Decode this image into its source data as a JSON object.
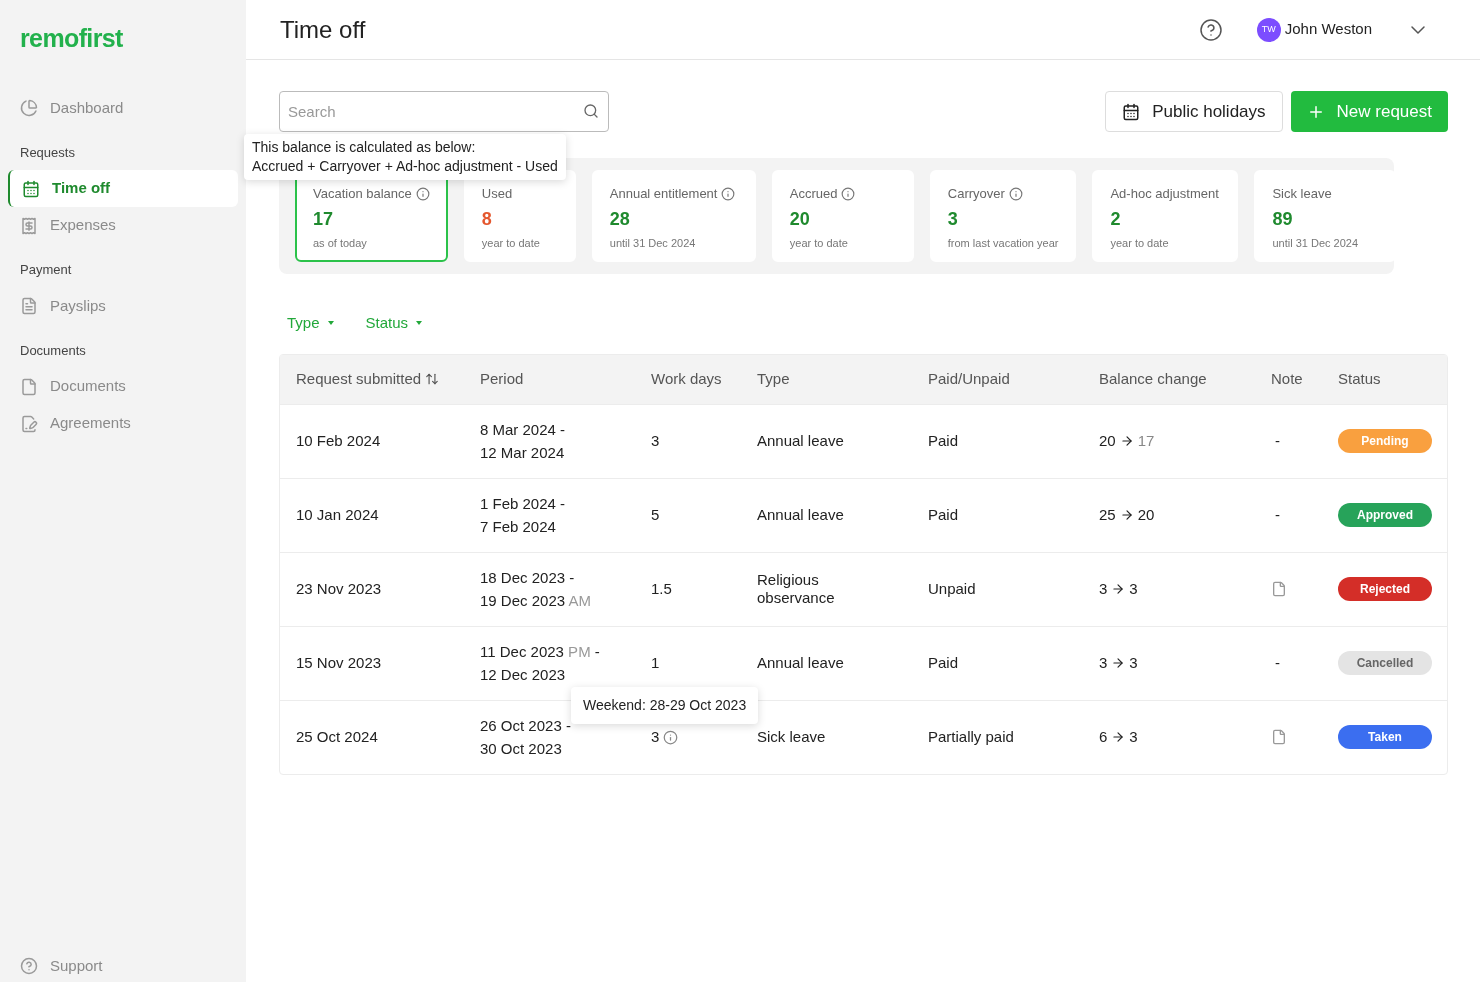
{
  "sidebar": {
    "logo": "remofirst",
    "sections": [
      {
        "items": [
          {
            "label": "Dashboard",
            "selected": false
          }
        ]
      },
      {
        "heading": "Requests",
        "items": [
          {
            "label": "Time off",
            "selected": true
          },
          {
            "label": "Expenses",
            "selected": false
          }
        ]
      },
      {
        "heading": "Payment",
        "items": [
          {
            "label": "Payslips",
            "selected": false
          }
        ]
      },
      {
        "heading": "Documents",
        "items": [
          {
            "label": "Documents",
            "selected": false
          },
          {
            "label": "Agreements",
            "selected": false
          }
        ]
      }
    ],
    "support": "Support"
  },
  "header": {
    "title": "Time off",
    "user": {
      "initials": "TW",
      "name": "John Weston"
    }
  },
  "search": {
    "placeholder": "Search"
  },
  "buttons": {
    "public_holidays": "Public holidays",
    "new_request": "New request"
  },
  "balance_tooltip": [
    "This balance is calculated as below:",
    "Accrued + Carryover + Ad-hoc adjustment - Used"
  ],
  "cards": [
    {
      "label": "Vacation balance",
      "info": true,
      "value": "17",
      "caption": "as of today",
      "color": "#1f8a2e",
      "selected": true
    },
    {
      "label": "Used",
      "info": false,
      "value": "8",
      "caption": "year to date",
      "color": "#e4572e",
      "selected": false
    },
    {
      "label": "Annual entitlement",
      "info": true,
      "value": "28",
      "caption": "until 31 Dec 2024",
      "color": "#1f8a2e",
      "selected": false
    },
    {
      "label": "Accrued",
      "info": true,
      "value": "20",
      "caption": "year to date",
      "color": "#1f8a2e",
      "selected": false
    },
    {
      "label": "Carryover",
      "info": true,
      "value": "3",
      "caption": "from last vacation year",
      "color": "#1f8a2e",
      "selected": false
    },
    {
      "label": "Ad-hoc adjustment",
      "info": false,
      "value": "2",
      "caption": "year to date",
      "color": "#1f8a2e",
      "selected": false
    },
    {
      "label": "Sick leave",
      "info": false,
      "value": "89",
      "caption": "until 31 Dec 2024",
      "color": "#1f8a2e",
      "selected": false
    }
  ],
  "filters": [
    "Type",
    "Status"
  ],
  "table": {
    "columns": [
      {
        "label": "Request submitted",
        "sortable": true
      },
      {
        "label": "Period",
        "sortable": false
      },
      {
        "label": "Work days",
        "sortable": false
      },
      {
        "label": "Type",
        "sortable": false
      },
      {
        "label": "Paid/Unpaid",
        "sortable": false
      },
      {
        "label": "Balance change",
        "sortable": false
      },
      {
        "label": "Note",
        "sortable": false
      },
      {
        "label": "Status",
        "sortable": false
      }
    ],
    "rows": [
      {
        "submitted": "10 Feb 2024",
        "period": [
          {
            "date": "8 Mar 2024",
            "sep": "-"
          },
          {
            "date": "12 Mar 2024"
          }
        ],
        "work_days": "3",
        "work_days_info": false,
        "type": "Annual leave",
        "paid": "Paid",
        "balance_from": "20",
        "balance_to": "17",
        "balance_to_muted": true,
        "note": {
          "kind": "dash",
          "text": "-"
        },
        "status": {
          "label": "Pending",
          "color": "#f9a03f"
        }
      },
      {
        "submitted": "10 Jan 2024",
        "period": [
          {
            "date": "1 Feb 2024",
            "sep": "-"
          },
          {
            "date": "7 Feb 2024"
          }
        ],
        "work_days": "5",
        "work_days_info": false,
        "type": "Annual leave",
        "paid": "Paid",
        "balance_from": "25",
        "balance_to": "20",
        "balance_to_muted": false,
        "note": {
          "kind": "dash",
          "text": "-"
        },
        "status": {
          "label": "Approved",
          "color": "#27a35a"
        }
      },
      {
        "submitted": "23 Nov 2023",
        "period": [
          {
            "date": "18 Dec 2023",
            "sep": "-"
          },
          {
            "date": "19 Dec 2023",
            "half": "AM"
          }
        ],
        "work_days": "1.5",
        "work_days_info": false,
        "type": "Religious observance",
        "paid": "Unpaid",
        "balance_from": "3",
        "balance_to": "3",
        "balance_to_muted": false,
        "note": {
          "kind": "document"
        },
        "status": {
          "label": "Rejected",
          "color": "#d42e28"
        }
      },
      {
        "submitted": "15 Nov 2023",
        "period": [
          {
            "date": "11 Dec 2023",
            "half": "PM",
            "sep": "-"
          },
          {
            "date": "12 Dec 2023"
          }
        ],
        "work_days": "1",
        "work_days_info": false,
        "type": "Annual leave",
        "paid": "Paid",
        "balance_from": "3",
        "balance_to": "3",
        "balance_to_muted": false,
        "note": {
          "kind": "dash",
          "text": "-"
        },
        "status": {
          "label": "Cancelled",
          "color": "#e4e4e4"
        }
      },
      {
        "submitted": "25 Oct 2024",
        "period": [
          {
            "date": "26 Oct 2023",
            "sep": "-"
          },
          {
            "date": "30 Oct 2023"
          }
        ],
        "work_days": "3",
        "work_days_info": true,
        "work_days_tooltip": "Weekend: 28-29 Oct 2023",
        "type": "Sick leave",
        "paid": "Partially paid",
        "balance_from": "6",
        "balance_to": "3",
        "balance_to_muted": false,
        "note": {
          "kind": "document"
        },
        "status": {
          "label": "Taken",
          "color": "#3b6ef0"
        }
      }
    ]
  }
}
